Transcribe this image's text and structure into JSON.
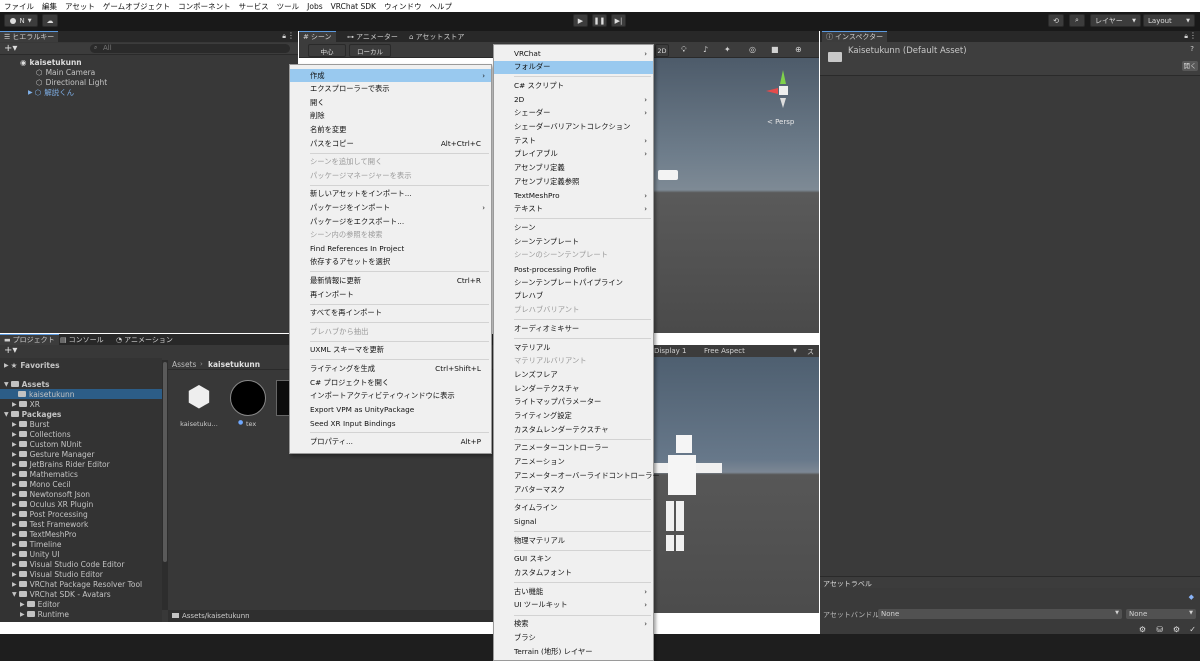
{
  "menubar": {
    "items": [
      "ファイル",
      "編集",
      "アセット",
      "ゲームオブジェクト",
      "コンポーネント",
      "サービス",
      "ツール",
      "Jobs",
      "VRChat SDK",
      "ウィンドウ",
      "ヘルプ"
    ]
  },
  "toolbar": {
    "account": "N",
    "layers": "レイヤー",
    "layout": "Layout"
  },
  "hierarchy": {
    "tab": "ヒエラルキー",
    "search_placeholder": "All",
    "scene": "kaisetukunn",
    "items": [
      "Main Camera",
      "Directional Light",
      "解説くん"
    ]
  },
  "scene_tabs": [
    "シーン",
    "アニメーター",
    "アセットストア"
  ],
  "scene_toolbar": {
    "pivot": "中心",
    "space": "ローカル",
    "mode_2d": "2D",
    "persp": "< Persp"
  },
  "game_toolbar": {
    "display": "Display 1",
    "aspect": "Free Aspect",
    "scale": "ス"
  },
  "inspector": {
    "tab": "インスペクター",
    "title": "Kaisetukunn (Default Asset)",
    "open_button": "開く",
    "asset_labels": "アセットラベル",
    "asset_bundle": "アセットバンドル",
    "bundle_value": "None",
    "variant_value": "None"
  },
  "project": {
    "tabs": [
      "プロジェクト",
      "コンソール",
      "アニメーション"
    ],
    "favorites": "Favorites",
    "assets": "Assets",
    "assets_children": [
      "kaisetukunn",
      "XR"
    ],
    "packages": "Packages",
    "package_items": [
      "Burst",
      "Collections",
      "Custom NUnit",
      "Gesture Manager",
      "JetBrains Rider Editor",
      "Mathematics",
      "Mono Cecil",
      "Newtonsoft Json",
      "Oculus XR Plugin",
      "Post Processing",
      "Test Framework",
      "TextMeshPro",
      "Timeline",
      "Unity UI",
      "Visual Studio Code Editor",
      "Visual Studio Editor",
      "VRChat Package Resolver Tool",
      "VRChat SDK - Avatars"
    ],
    "sdk_children": [
      "Editor",
      "Runtime"
    ],
    "breadcrumb_root": "Assets",
    "breadcrumb_current": "kaisetukunn",
    "files": [
      "kaisetuku…",
      "tex"
    ],
    "footer_path": "Assets/kaisetukunn"
  },
  "context_menu": {
    "items": [
      {
        "label": "作成",
        "submenu": true,
        "selected": true
      },
      {
        "label": "エクスプローラーで表示"
      },
      {
        "label": "開く"
      },
      {
        "label": "削除"
      },
      {
        "label": "名前を変更"
      },
      {
        "label": "パスをコピー",
        "shortcut": "Alt+Ctrl+C"
      },
      {
        "label": "シーンを追加して開く",
        "disabled": true
      },
      {
        "label": "パッケージマネージャーを表示",
        "disabled": true
      },
      {
        "label": "新しいアセットをインポート..."
      },
      {
        "label": "パッケージをインポート",
        "submenu": true
      },
      {
        "label": "パッケージをエクスポート..."
      },
      {
        "label": "シーン内の参照を検索",
        "disabled": true
      },
      {
        "label": "Find References In Project"
      },
      {
        "label": "依存するアセットを選択"
      },
      {
        "label": "最新情報に更新",
        "shortcut": "Ctrl+R"
      },
      {
        "label": "再インポート"
      },
      {
        "label": "すべてを再インポート"
      },
      {
        "label": "プレハブから抽出",
        "disabled": true
      },
      {
        "label": "UXML スキーマを更新"
      },
      {
        "label": "ライティングを生成",
        "shortcut": "Ctrl+Shift+L"
      },
      {
        "label": "C# プロジェクトを開く"
      },
      {
        "label": "インポートアクティビティウィンドウに表示"
      },
      {
        "label": "Export VPM as UnityPackage"
      },
      {
        "label": "Seed XR Input Bindings"
      },
      {
        "label": "プロパティ...",
        "shortcut": "Alt+P"
      }
    ]
  },
  "create_menu": {
    "items": [
      {
        "label": "VRChat",
        "submenu": true
      },
      {
        "label": "フォルダー",
        "selected": true
      },
      {
        "label": "C# スクリプト"
      },
      {
        "label": "2D",
        "submenu": true
      },
      {
        "label": "シェーダー",
        "submenu": true
      },
      {
        "label": "シェーダーバリアントコレクション"
      },
      {
        "label": "テスト",
        "submenu": true
      },
      {
        "label": "プレイアブル",
        "submenu": true
      },
      {
        "label": "アセンブリ定義"
      },
      {
        "label": "アセンブリ定義参照"
      },
      {
        "label": "TextMeshPro",
        "submenu": true
      },
      {
        "label": "テキスト",
        "submenu": true
      },
      {
        "label": "シーン"
      },
      {
        "label": "シーンテンプレート"
      },
      {
        "label": "シーンのシーンテンプレート",
        "disabled": true
      },
      {
        "label": "Post-processing Profile"
      },
      {
        "label": "シーンテンプレートパイプライン"
      },
      {
        "label": "プレハブ"
      },
      {
        "label": "プレハブバリアント",
        "disabled": true
      },
      {
        "label": "オーディオミキサー"
      },
      {
        "label": "マテリアル"
      },
      {
        "label": "マテリアルバリアント",
        "disabled": true
      },
      {
        "label": "レンズフレア"
      },
      {
        "label": "レンダーテクスチャ"
      },
      {
        "label": "ライトマップパラメーター"
      },
      {
        "label": "ライティング設定"
      },
      {
        "label": "カスタムレンダーテクスチャ"
      },
      {
        "label": "アニメーターコントローラー"
      },
      {
        "label": "アニメーション"
      },
      {
        "label": "アニメーターオーバーライドコントローラー"
      },
      {
        "label": "アバターマスク"
      },
      {
        "label": "タイムライン"
      },
      {
        "label": "Signal"
      },
      {
        "label": "物理マテリアル"
      },
      {
        "label": "GUI スキン"
      },
      {
        "label": "カスタムフォント"
      },
      {
        "label": "古い機能",
        "submenu": true
      },
      {
        "label": "UI ツールキット",
        "submenu": true
      },
      {
        "label": "検索",
        "submenu": true
      },
      {
        "label": "ブラシ"
      },
      {
        "label": "Terrain (地形) レイヤー"
      }
    ]
  }
}
